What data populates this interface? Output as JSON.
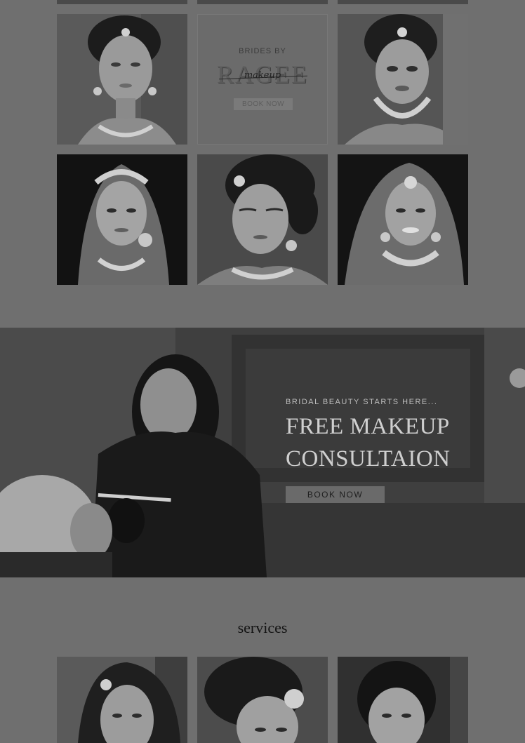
{
  "gallery": {
    "logo_tile": {
      "small_text": "BRIDES BY",
      "big_text": "RAGEE",
      "script_text": "makeup",
      "button_label": "BOOK NOW"
    }
  },
  "banner": {
    "kicker": "BRIDAL BEAUTY STARTS HERE...",
    "title_line1": "FREE MAKEUP",
    "title_line2": "CONSULTAION",
    "button_label": "BOOK NOW"
  },
  "services": {
    "heading": "services"
  }
}
